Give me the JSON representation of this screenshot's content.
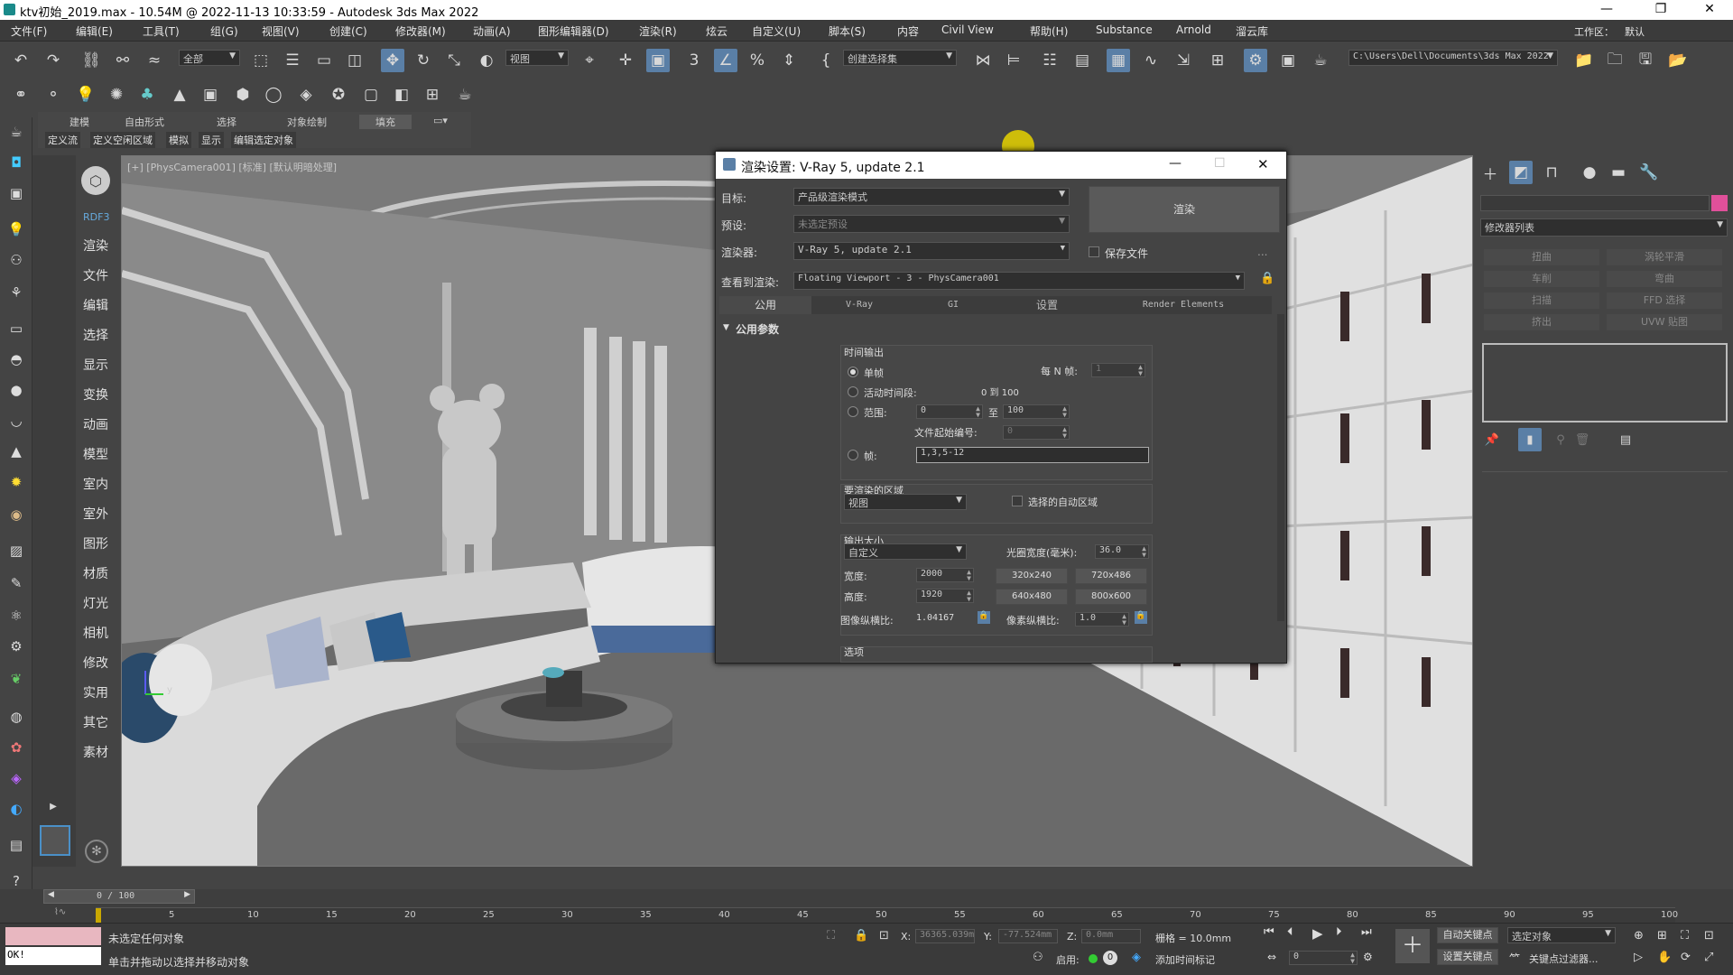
{
  "window": {
    "title": "ktv初始_2019.max - 10.54M @ 2022-11-13 10:33:59 - Autodesk 3ds Max 2022",
    "minimize": "—",
    "restore": "❐",
    "close": "✕"
  },
  "menu": [
    "文件(F)",
    "编辑(E)",
    "工具(T)",
    "组(G)",
    "视图(V)",
    "创建(C)",
    "修改器(M)",
    "动画(A)",
    "图形编辑器(D)",
    "渲染(R)",
    "炫云",
    "自定义(U)",
    "脚本(S)",
    "内容",
    "Civil View",
    "帮助(H)",
    "Substance",
    "Arnold",
    "溜云库"
  ],
  "workspace": {
    "label": "工作区：",
    "value": "默认"
  },
  "toolbar": {
    "selection_filter": "全部",
    "ref_coord": "视图",
    "named_selection": "创建选择集",
    "project_path": "C:\\Users\\Dell\\Documents\\3ds Max 2022"
  },
  "ribbon": {
    "tabs": [
      "建模",
      "自由形式",
      "选择",
      "对象绘制",
      "填充"
    ],
    "subtabs": [
      "定义流",
      "定义空闲区域",
      "模拟",
      "显示",
      "编辑选定对象"
    ]
  },
  "command_column": {
    "header": "RDF3",
    "items": [
      "渲染",
      "文件",
      "编辑",
      "选择",
      "显示",
      "变换",
      "动画",
      "模型",
      "室内",
      "室外",
      "图形",
      "材质",
      "灯光",
      "相机",
      "修改",
      "实用",
      "其它",
      "素材"
    ]
  },
  "viewport": {
    "label": "[+] [PhysCamera001] [标准] [默认明暗处理]",
    "axis_y": "y"
  },
  "dialog": {
    "title": "渲染设置: V-Ray 5, update 2.1",
    "target_label": "目标:",
    "target_value": "产品级渲染模式",
    "preset_label": "预设:",
    "preset_value": "未选定预设",
    "renderer_label": "渲染器:",
    "renderer_value": "V-Ray 5, update 2.1",
    "render_button": "渲染",
    "save_file_label": "保存文件",
    "more": "...",
    "view_label": "查看到渲染:",
    "view_value": "Floating Viewport - 3 - PhysCamera001",
    "tabs": [
      "公用",
      "V-Ray",
      "GI",
      "设置",
      "Render Elements"
    ],
    "rollout_title": "公用参数",
    "time_output": {
      "title": "时间输出",
      "single": "单帧",
      "every_n_label": "每 N 帧:",
      "every_n_value": "1",
      "active_segment": "活动时间段:",
      "active_range": "0 到 100",
      "range_label": "范围:",
      "range_from": "0",
      "range_to_label": "至",
      "range_to": "100",
      "file_start_label": "文件起始编号:",
      "file_start_value": "0",
      "frames_label": "帧:",
      "frames_value": "1,3,5-12"
    },
    "area": {
      "title": "要渲染的区域",
      "value": "视图",
      "auto_region": "选择的自动区域"
    },
    "output_size": {
      "title": "输出大小",
      "preset": "自定义",
      "aperture_label": "光圈宽度(毫米):",
      "aperture_value": "36.0",
      "width_label": "宽度:",
      "width_value": "2000",
      "height_label": "高度:",
      "height_value": "1920",
      "presets": [
        "320x240",
        "720x486",
        "640x480",
        "800x600"
      ],
      "image_aspect_label": "图像纵横比:",
      "image_aspect_value": "1.04167",
      "pixel_aspect_label": "像素纵横比:",
      "pixel_aspect_value": "1.0"
    },
    "options_title": "选项"
  },
  "right_panel": {
    "modifier_list": "修改器列表",
    "buttons": [
      "扭曲",
      "涡轮平滑",
      "车削",
      "弯曲",
      "扫描",
      "FFD 选择",
      "挤出",
      "UVW 贴图"
    ]
  },
  "timeline": {
    "frame_display": "0 / 100",
    "ticks": [
      "5",
      "10",
      "15",
      "20",
      "25",
      "30",
      "35",
      "40",
      "45",
      "50",
      "55",
      "60",
      "65",
      "70",
      "75",
      "80",
      "85",
      "90",
      "95",
      "100"
    ]
  },
  "status": {
    "maxscript_output": "OK!",
    "selection": "未选定任何对象",
    "prompt": "单击并拖动以选择并移动对象",
    "x_label": "X:",
    "x_value": "36365.039m",
    "y_label": "Y:",
    "y_value": "-77.524mm",
    "z_label": "Z:",
    "z_value": "0.0mm",
    "grid": "栅格 = 10.0mm",
    "enable": "启用:",
    "add_time_tag": "添加时间标记",
    "auto_key": "自动关键点",
    "selected_object": "选定对象",
    "set_key": "设置关键点",
    "key_filter": "关键点过滤器...",
    "current_frame": "0"
  },
  "colors": {
    "accent": "#5a7fa6",
    "swatch": "#e0509a",
    "status_pink": "#e8b7c0"
  }
}
